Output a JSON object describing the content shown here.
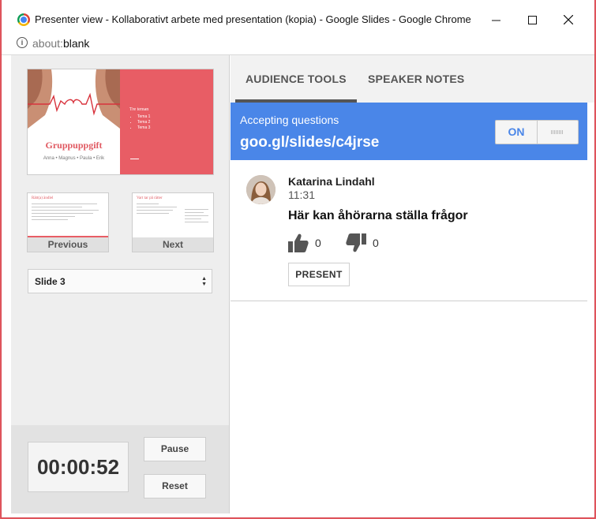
{
  "window": {
    "title": "Presenter view - Kollaborativt arbete med presentation (kopia) - Google Slides - Google Chrome"
  },
  "address_bar": {
    "url_scheme": "about:",
    "url_rest": "blank"
  },
  "current_slide": {
    "title": "Gruppuppgift",
    "subtitle": "Anna • Magnus • Paula • Erik",
    "right_heading": "Tre teman",
    "bullets": [
      "Tema 1",
      "Tema 2",
      "Tema 3"
    ]
  },
  "previous_slide": {
    "label": "Previous",
    "thumb_title": "Rätt(a) ändlel"
  },
  "next_slide": {
    "label": "Next",
    "thumb_title": "Vart tar på rätter"
  },
  "slide_select": {
    "value": "Slide 3"
  },
  "timer": {
    "value": "00:00:52",
    "pause_label": "Pause",
    "reset_label": "Reset"
  },
  "tabs": [
    {
      "label": "AUDIENCE TOOLS",
      "active": true
    },
    {
      "label": "SPEAKER NOTES",
      "active": false
    }
  ],
  "qa_banner": {
    "status": "Accepting questions",
    "url": "goo.gl/slides/c4jrse",
    "toggle_label": "ON",
    "color": "#4a86e8"
  },
  "question": {
    "author": "Katarina Lindahl",
    "time": "11:31",
    "text": "Här kan åhörarna ställa frågor",
    "upvotes": "0",
    "downvotes": "0",
    "present_label": "PRESENT"
  },
  "colors": {
    "accent": "#e85d65",
    "background": "#e25a61"
  }
}
